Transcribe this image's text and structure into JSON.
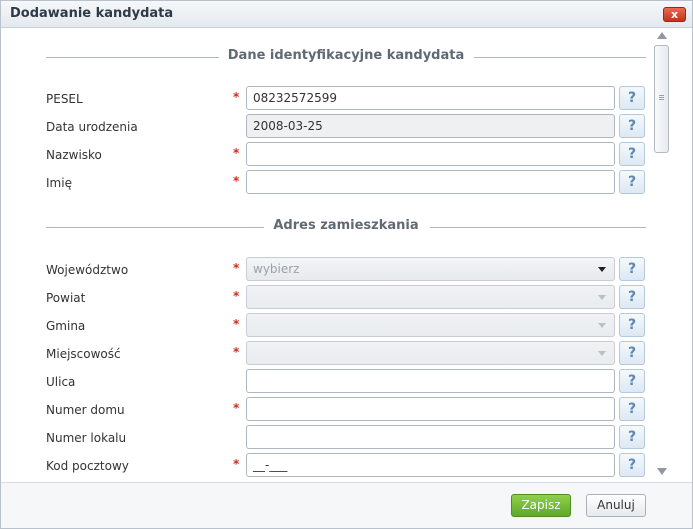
{
  "window": {
    "title": "Dodawanie kandydata",
    "close_label": "x"
  },
  "sections": {
    "identification": "Dane identyfikacyjne kandydata",
    "address": "Adres zamieszkania"
  },
  "required_mark": "*",
  "help_label": "?",
  "fields": {
    "pesel": {
      "label": "PESEL",
      "value": "08232572599"
    },
    "birth_date": {
      "label": "Data urodzenia",
      "value": "2008-03-25"
    },
    "surname": {
      "label": "Nazwisko",
      "value": ""
    },
    "first_name": {
      "label": "Imię",
      "value": ""
    },
    "voivodeship": {
      "label": "Województwo",
      "value": "wybierz"
    },
    "county": {
      "label": "Powiat",
      "value": ""
    },
    "commune": {
      "label": "Gmina",
      "value": ""
    },
    "locality": {
      "label": "Miejscowość",
      "value": ""
    },
    "street": {
      "label": "Ulica",
      "value": ""
    },
    "house_number": {
      "label": "Numer domu",
      "value": ""
    },
    "apartment_number": {
      "label": "Numer lokalu",
      "value": ""
    },
    "postal_code": {
      "label": "Kod pocztowy",
      "value": "__-___"
    }
  },
  "buttons": {
    "save": "Zapisz",
    "cancel": "Anuluj"
  },
  "colors": {
    "save_button": "#6db334",
    "close_button": "#d2412b",
    "required": "#d8281d",
    "help_text": "#5d88b4"
  }
}
